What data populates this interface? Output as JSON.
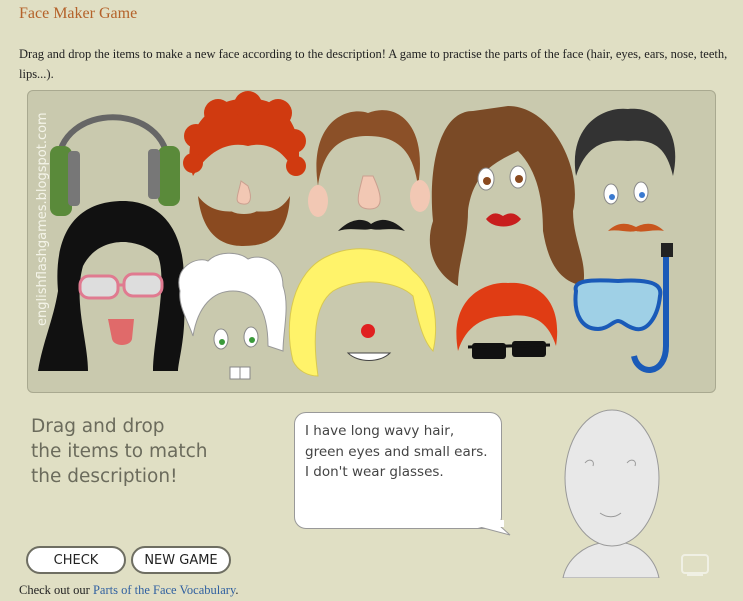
{
  "page": {
    "title": "Face Maker Game",
    "intro": "Drag and drop the items to make a new face according to the description! A game to practise the parts of the face (hair, eyes, ears, nose, teeth, lips...)."
  },
  "game": {
    "watermark": "englishflashgames.blogspot.com",
    "instructions": [
      "Drag and drop",
      "the items to match",
      "the description!"
    ],
    "description": [
      "I have long wavy hair,",
      "green eyes and small ears.",
      "I don't wear glasses."
    ],
    "buttons": {
      "check": "CHECK",
      "new_game": "NEW GAME"
    },
    "pieces": [
      "headphones",
      "red curly hair",
      "beard",
      "brown hair",
      "big nose",
      "mustache",
      "long wavy brown hair",
      "brown eyes",
      "red lips",
      "black short hair",
      "blue eyes",
      "ginger mustache",
      "long black hair",
      "pink glasses",
      "tongue",
      "white curly hair",
      "green eyes",
      "buck teeth",
      "blonde hair",
      "red nose",
      "smile with teeth",
      "red short hair",
      "sunglasses",
      "diving mask",
      "snorkel"
    ]
  },
  "footer": {
    "prefix": "Check out our ",
    "link": "Parts of the Face Vocabulary",
    "suffix": "."
  },
  "colors": {
    "background": "#e0dfc4",
    "board": "#c9c9ae",
    "title": "#b4622a",
    "link": "#3060a0"
  }
}
